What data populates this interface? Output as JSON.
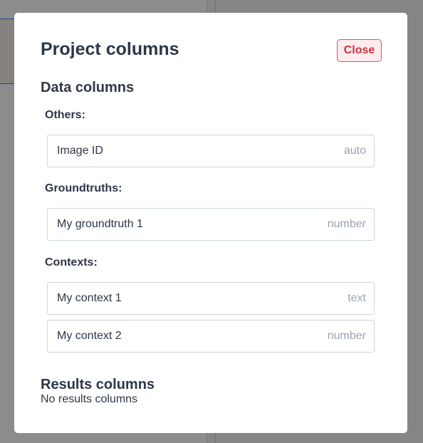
{
  "modal": {
    "title": "Project columns",
    "close_label": "Close"
  },
  "data_columns": {
    "heading": "Data columns",
    "groups": [
      {
        "label": "Others:",
        "columns": [
          {
            "name": "Image ID",
            "type": "auto"
          }
        ]
      },
      {
        "label": "Groundtruths:",
        "columns": [
          {
            "name": "My groundtruth 1",
            "type": "number"
          }
        ]
      },
      {
        "label": "Contexts:",
        "columns": [
          {
            "name": "My context 1",
            "type": "text"
          },
          {
            "name": "My context 2",
            "type": "number"
          }
        ]
      }
    ]
  },
  "results_columns": {
    "heading": "Results columns",
    "empty_text": "No results columns"
  },
  "colors": {
    "heading_text": "#2d3748",
    "type_text": "#9aa3ad",
    "close_border": "#e05563",
    "close_text": "#d0343f",
    "close_bg": "#fdecee",
    "row_border": "#cbd5e0"
  }
}
